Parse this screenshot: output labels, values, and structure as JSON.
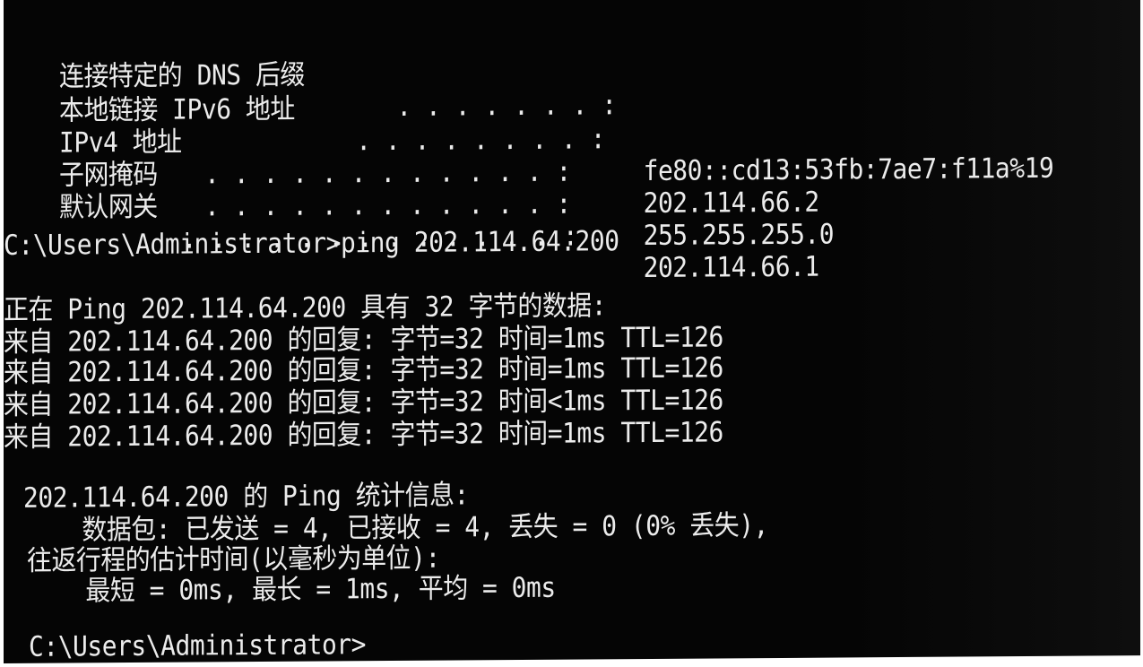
{
  "ipconfig": {
    "rows": [
      {
        "label": "连接特定的 DNS 后缀",
        "dots": " . . . . . . . :",
        "value": ""
      },
      {
        "label": "本地链接 IPv6 地址",
        "dots": ". . . . . . . . :",
        "value": "fe80::cd13:53fb:7ae7:f11a%19"
      },
      {
        "label": "IPv4 地址",
        "dots": " . . . . . . . . . . . . :",
        "value": "202.114.66.2"
      },
      {
        "label": "子网掩码",
        "dots": " . . . . . . . . . . . . :",
        "value": "255.255.255.0"
      },
      {
        "label": "默认网关",
        "dots": ". . . . . . . . . . . . . :",
        "value": "202.114.66.1"
      }
    ]
  },
  "command": {
    "prompt": "C:\\Users\\Administrator>",
    "input": "ping 202.114.64.200"
  },
  "ping": {
    "header": "正在 Ping 202.114.64.200 具有 32 字节的数据:",
    "replies": [
      "来自 202.114.64.200 的回复: 字节=32 时间=1ms TTL=126",
      "来自 202.114.64.200 的回复: 字节=32 时间=1ms TTL=126",
      "来自 202.114.64.200 的回复: 字节=32 时间<1ms TTL=126",
      "来自 202.114.64.200 的回复: 字节=32 时间=1ms TTL=126"
    ],
    "stats_title": "202.114.64.200 的 Ping 统计信息:",
    "packets": "    数据包: 已发送 = 4, 已接收 = 4, 丢失 = 0 (0% 丢失),",
    "rtt_title": "往返行程的估计时间(以毫秒为单位):",
    "rtt_values": "    最短 = 0ms, 最长 = 1ms, 平均 = 0ms"
  },
  "final_prompt": "C:\\Users\\Administrator>"
}
